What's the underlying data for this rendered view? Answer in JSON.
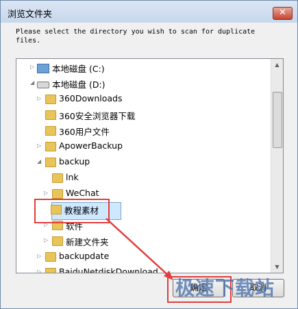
{
  "window": {
    "title": "浏览文件夹",
    "close_glyph": "✕"
  },
  "instructions": "Please select the directory you wish to scan for duplicate\nfiles.",
  "tree": {
    "items": [
      {
        "label": "本地磁盘 (C:)",
        "icon": "system-drive-icon",
        "arrow": "▷"
      },
      {
        "label": "本地磁盘 (D:)",
        "icon": "drive-icon",
        "arrow": "◢"
      },
      {
        "label": "360Downloads",
        "icon": "folder-icon",
        "arrow": "▷"
      },
      {
        "label": "360安全浏览器下载",
        "icon": "folder-icon",
        "arrow": ""
      },
      {
        "label": "360用户文件",
        "icon": "folder-icon",
        "arrow": ""
      },
      {
        "label": "ApowerBackup",
        "icon": "folder-icon",
        "arrow": "▷"
      },
      {
        "label": "backup",
        "icon": "folder-icon",
        "arrow": "◢"
      },
      {
        "label": "lnk",
        "icon": "folder-icon",
        "arrow": ""
      },
      {
        "label": "WeChat",
        "icon": "folder-icon",
        "arrow": "▷"
      },
      {
        "label": "教程素材",
        "icon": "folder-icon",
        "arrow": "",
        "selected": true
      },
      {
        "label": "软件",
        "icon": "folder-icon",
        "arrow": "▷"
      },
      {
        "label": "新建文件夹",
        "icon": "folder-icon",
        "arrow": "▷"
      },
      {
        "label": "backupdate",
        "icon": "folder-icon",
        "arrow": "▷"
      },
      {
        "label": "BaiduNetdiskDownload",
        "icon": "folder-icon",
        "arrow": "▷"
      }
    ]
  },
  "scrollbar": {
    "up": "▲",
    "down": "▼"
  },
  "buttons": {
    "ok": "确定",
    "cancel": "取消"
  },
  "watermark": "极速下载站",
  "annotation_color": "#e23c3c"
}
